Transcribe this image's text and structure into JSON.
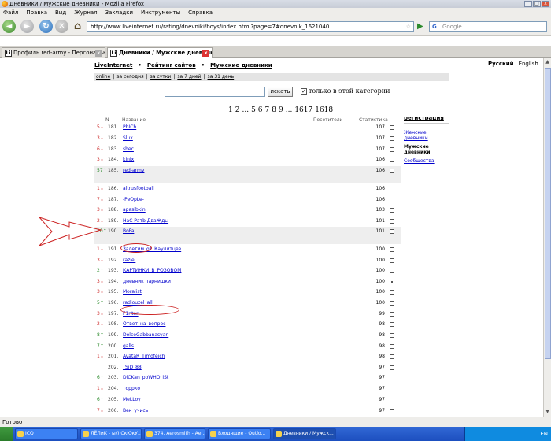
{
  "window": {
    "title": "Дневники / Мужские дневники - Mozilla Firefox"
  },
  "menu": [
    "Файл",
    "Правка",
    "Вид",
    "Журнал",
    "Закладки",
    "Инструменты",
    "Справка"
  ],
  "navbar": {
    "url": "http://www.liveinternet.ru/rating/dnevniki/boys/index.html?page=7#dnevnik_1621040",
    "search_placeholder": "Google"
  },
  "tabs": [
    {
      "label": "Профиль red-army - Персональна...",
      "favicon": "Li"
    },
    {
      "label": "Дневники / Мужские дневники",
      "favicon": "Li"
    }
  ],
  "page": {
    "langs": [
      "Русский",
      "English"
    ],
    "topnav": {
      "site": "LiveInternet",
      "sep": "•",
      "rating": "Рейтинг сайтов",
      "section": "Мужские дневники"
    },
    "filters": [
      "online",
      "|",
      "за сегодня",
      "|",
      "за сутки",
      "|",
      "за 7 дней",
      "|",
      "за 31 день"
    ],
    "search": {
      "button": "искать",
      "checkbox_label": "только в этой категории"
    },
    "pager": [
      "1",
      "2",
      "...",
      "5",
      "6",
      "7",
      "8",
      "9",
      "...",
      "1617",
      "1618"
    ],
    "columns": {
      "n": "N",
      "name": "Название",
      "visitors": "Посетители",
      "stats": "Статистика"
    },
    "rows": [
      {
        "chg": "5↓",
        "dir": "down",
        "num": "181.",
        "name": "PbICb",
        "score": "107"
      },
      {
        "chg": "3↓",
        "dir": "down",
        "num": "182.",
        "name": "Slux",
        "score": "107"
      },
      {
        "chg": "6↓",
        "dir": "down",
        "num": "183.",
        "name": "shec",
        "score": "107"
      },
      {
        "chg": "3↓",
        "dir": "down",
        "num": "184.",
        "name": "kinix",
        "score": "106"
      },
      {
        "chg": "57↑",
        "dir": "up",
        "num": "185.",
        "name": "red-army",
        "score": "106"
      },
      {
        "chg": "1↓",
        "dir": "down",
        "num": "186.",
        "name": "altrusfootball",
        "score": "106"
      },
      {
        "chg": "7↓",
        "dir": "down",
        "num": "187.",
        "name": "-PeOpLe-",
        "score": "106"
      },
      {
        "chg": "3↓",
        "dir": "down",
        "num": "188.",
        "name": "apasibkin",
        "score": "103"
      },
      {
        "chg": "2↓",
        "dir": "down",
        "num": "189.",
        "name": "НаС Ратb ДваЖды",
        "score": "101"
      },
      {
        "chg": "20↑",
        "dir": "up",
        "num": "190.",
        "name": "BoFa",
        "score": "101"
      },
      {
        "chg": "1↓",
        "dir": "down",
        "num": "191.",
        "name": "Залетим_от_Каулитцев",
        "score": "100"
      },
      {
        "chg": "3↓",
        "dir": "down",
        "num": "192.",
        "name": "raziel",
        "score": "100"
      },
      {
        "chg": "2↑",
        "dir": "up",
        "num": "193.",
        "name": "КАРТИНКИ_В_РОЗОВОМ",
        "score": "100"
      },
      {
        "chg": "3↓",
        "dir": "down",
        "num": "194.",
        "name": "дневник парнишки",
        "score": "100",
        "checked": true
      },
      {
        "chg": "3↓",
        "dir": "down",
        "num": "195.",
        "name": "Moralist",
        "score": "100"
      },
      {
        "chg": "5↑",
        "dir": "up",
        "num": "196.",
        "name": "radiouzel_all",
        "score": "100"
      },
      {
        "chg": "3↓",
        "dir": "down",
        "num": "197.",
        "name": "F1nter",
        "score": "99"
      },
      {
        "chg": "2↓",
        "dir": "down",
        "num": "198.",
        "name": "Ответ_на_вопрос",
        "score": "98"
      },
      {
        "chg": "8↑",
        "dir": "up",
        "num": "199.",
        "name": "DolceGabbanasyan",
        "score": "98"
      },
      {
        "chg": "7↑",
        "dir": "up",
        "num": "200.",
        "name": "galls",
        "score": "98"
      },
      {
        "chg": "1↓",
        "dir": "down",
        "num": "201.",
        "name": "AvataR_Timofeich",
        "score": "98"
      },
      {
        "chg": "",
        "dir": "flat",
        "num": "202.",
        "name": "_SiD_88",
        "score": "97"
      },
      {
        "chg": "6↑",
        "dir": "up",
        "num": "203.",
        "name": "DiCKan_poWHO_iSt",
        "score": "97"
      },
      {
        "chg": "1↓",
        "dir": "down",
        "num": "204.",
        "name": "торрко",
        "score": "97"
      },
      {
        "chg": "6↑",
        "dir": "up",
        "num": "205.",
        "name": "MeLLoy",
        "score": "97"
      },
      {
        "chg": "7↓",
        "dir": "down",
        "num": "206.",
        "name": "Век_учись",
        "score": "97"
      }
    ],
    "sidebar": {
      "register": "регистрация",
      "women": "Женские дневники",
      "men": "Мужские дневники",
      "communities": "Сообщества"
    }
  },
  "status": "Готово",
  "taskbar": {
    "items": [
      "ICQ",
      "ЛЁЛиК - ы))|СкЮкУ...",
      "374. Aerosmith - Ae...",
      "Входящие - Outlo...",
      "Дневники / Мужск..."
    ],
    "tray_lang": "EN"
  },
  "colors": {
    "accent_up": "#2a8a2a",
    "accent_down": "#cc2a2a",
    "link": "#0000cc",
    "annotation": "#cc2222"
  }
}
